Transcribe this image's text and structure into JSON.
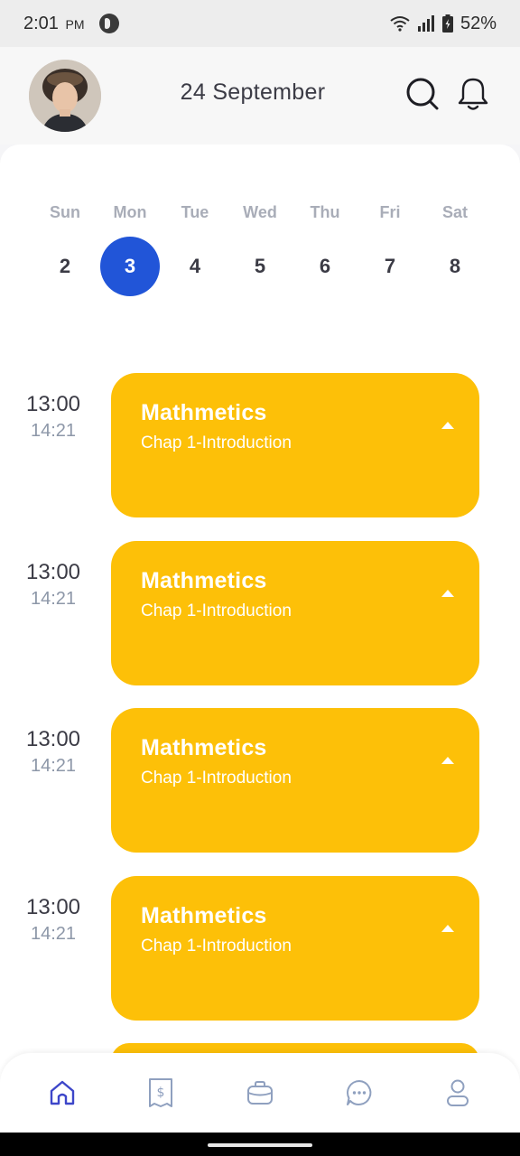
{
  "status_bar": {
    "time": "2:01",
    "ampm": "PM",
    "battery": "52%"
  },
  "header": {
    "date": "24 September",
    "icons": [
      "avatar",
      "search-icon",
      "bell-icon"
    ]
  },
  "week": [
    {
      "name": "Sun",
      "num": "2"
    },
    {
      "name": "Mon",
      "num": "3"
    },
    {
      "name": "Tue",
      "num": "4"
    },
    {
      "name": "Wed",
      "num": "5"
    },
    {
      "name": "Thu",
      "num": "6"
    },
    {
      "name": "Fri",
      "num": "7"
    },
    {
      "name": "Sat",
      "num": "8"
    }
  ],
  "selected_day": "3",
  "schedule": [
    {
      "start": "13:00",
      "end": "14:21",
      "title": "Mathmetics",
      "subtitle": "Chap 1-Introduction"
    },
    {
      "start": "13:00",
      "end": "14:21",
      "title": "Mathmetics",
      "subtitle": "Chap 1-Introduction"
    },
    {
      "start": "13:00",
      "end": "14:21",
      "title": "Mathmetics",
      "subtitle": "Chap 1-Introduction"
    },
    {
      "start": "13:00",
      "end": "14:21",
      "title": "Mathmetics",
      "subtitle": "Chap 1-Introduction"
    }
  ],
  "bottom_nav": [
    "home-icon",
    "receipt-icon",
    "briefcase-icon",
    "chat-icon",
    "profile-icon"
  ],
  "colors": {
    "accent": "#2155d8",
    "card": "#fdc008",
    "nav_active": "#3d46c9",
    "nav_inactive": "#8fa0bf"
  }
}
